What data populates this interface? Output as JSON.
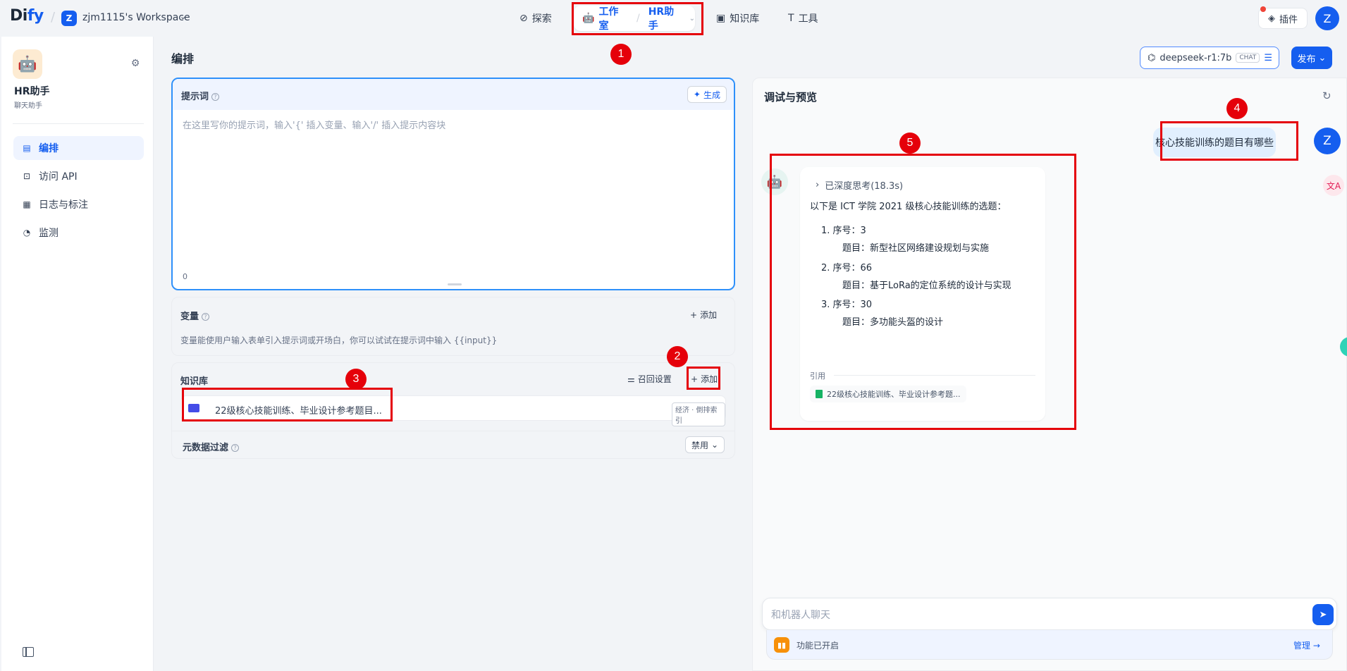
{
  "topbar": {
    "logo_a": "Di",
    "logo_b": "fy",
    "workspace_initial": "Z",
    "workspace_name": "zjm1115's Workspace",
    "nav_explore": "探索",
    "nav_studio": "工作室",
    "nav_app": "HR助手",
    "nav_knowledge": "知识库",
    "nav_tools": "工具",
    "plugins": "插件",
    "user_initial": "Z"
  },
  "sidebar": {
    "app_name": "HR助手",
    "app_type": "聊天助手",
    "items": [
      {
        "label": "编排",
        "icon": "layout-icon",
        "active": true
      },
      {
        "label": "访问 API",
        "icon": "terminal-icon",
        "active": false
      },
      {
        "label": "日志与标注",
        "icon": "log-icon",
        "active": false
      },
      {
        "label": "监测",
        "icon": "monitor-icon",
        "active": false
      }
    ]
  },
  "orchestrate": {
    "title": "编排",
    "model_name": "deepseek-r1:7b",
    "model_tag": "CHAT",
    "publish": "发布",
    "prompt": {
      "label": "提示词",
      "generate": "生成",
      "placeholder": "在这里写你的提示词，输入'{' 插入变量、输入'/' 插入提示内容块",
      "count": "0"
    },
    "variables": {
      "label": "变量",
      "add": "添加",
      "description": "变量能使用户输入表单引入提示词或开场白，你可以试试在提示词中输入 {{input}}"
    },
    "knowledge": {
      "label": "知识库",
      "recall_settings": "召回设置",
      "add": "添加",
      "item_name": "22级核心技能训练、毕业设计参考题目...",
      "item_tag": "经济 · 倒排索引"
    },
    "metadata_filter": {
      "label": "元数据过滤",
      "value": "禁用"
    }
  },
  "debug": {
    "title": "调试与预览",
    "user_message": "核心技能训练的题目有哪些",
    "user_initial": "Z",
    "thinking": "已深度思考(18.3s)",
    "answer_intro": "以下是 ICT 学院 2021 级核心技能训练的选题：",
    "answers": [
      {
        "num": "1. 序号：3",
        "topic": "题目：新型社区网络建设规划与实施"
      },
      {
        "num": "2. 序号：66",
        "topic": "题目：基于LoRa的定位系统的设计与实现"
      },
      {
        "num": "3. 序号：30",
        "topic": "题目：多功能头盔的设计"
      }
    ],
    "citation_label": "引用",
    "citation_file": "22级核心技能训练、毕业设计参考题...",
    "chat_placeholder": "和机器人聊天",
    "feature_text": "功能已开启",
    "manage": "管理"
  },
  "annotations": [
    "1",
    "2",
    "3",
    "4",
    "5"
  ],
  "colors": {
    "accent": "#155eef",
    "annotation_red": "#e5000a",
    "user_bubble": "#e1effe"
  }
}
